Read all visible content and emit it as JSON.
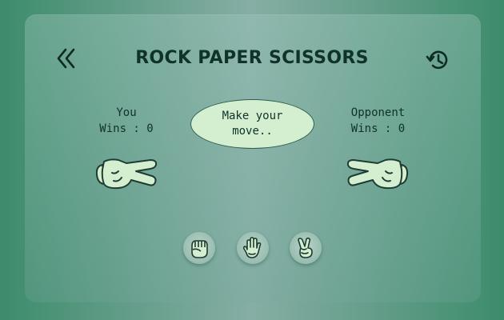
{
  "header": {
    "title": "ROCK PAPER SCISSORS",
    "back_icon": "double-chevron-left-icon",
    "history_icon": "history-icon"
  },
  "player": {
    "name": "You",
    "wins_text": "Wins : 0",
    "hand": "scissors"
  },
  "opponent": {
    "name": "Opponent",
    "wins_text": "Wins : 0",
    "hand": "scissors"
  },
  "status": {
    "message": "Make your move.."
  },
  "choices": [
    {
      "name": "rock",
      "icon": "fist-icon"
    },
    {
      "name": "paper",
      "icon": "open-hand-icon"
    },
    {
      "name": "scissors",
      "icon": "peace-hand-icon"
    }
  ],
  "colors": {
    "background": "#3d8c6c",
    "text": "#10322a",
    "hand_fill": "#d4efcf",
    "outline": "#1f3b33"
  }
}
